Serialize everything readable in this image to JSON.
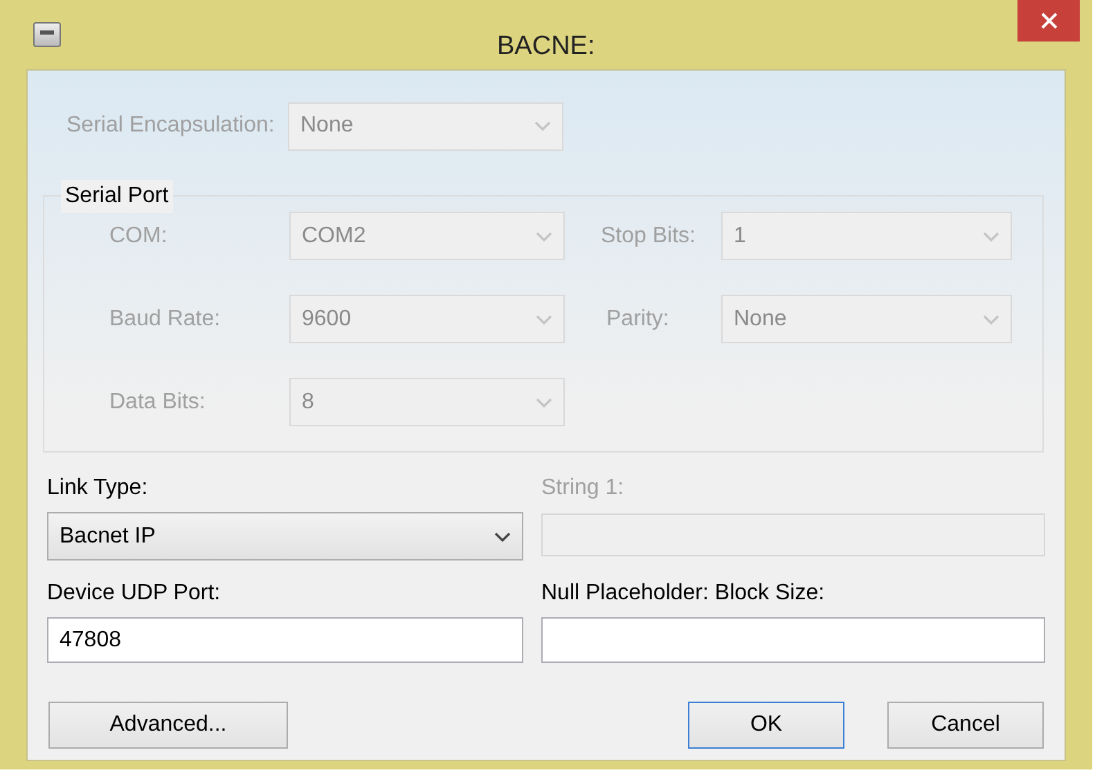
{
  "window": {
    "title": "BACNE:"
  },
  "serial_encapsulation": {
    "label": "Serial Encapsulation:",
    "value": "None",
    "disabled": true
  },
  "serial_port": {
    "title": "Serial Port",
    "fields": [
      {
        "label": "COM:",
        "value": "COM2",
        "disabled": true
      },
      {
        "label": "Stop Bits:",
        "value": "1",
        "disabled": true
      },
      {
        "label": "Baud Rate:",
        "value": "9600",
        "disabled": true
      },
      {
        "label": "Parity:",
        "value": "None",
        "disabled": true
      },
      {
        "label": "Data Bits:",
        "value": "8",
        "disabled": true
      }
    ]
  },
  "link_type": {
    "label": "Link Type:",
    "value": "Bacnet IP",
    "disabled": false
  },
  "string_1": {
    "label": "String 1:",
    "disabled": true
  },
  "device_udp_port": {
    "label": "Device UDP Port:",
    "value": "47808"
  },
  "null_placeholder": {
    "label": "Null Placeholder: Block Size:"
  },
  "buttons": [
    {
      "label": "Advanced...",
      "default": false
    },
    {
      "label": "OK",
      "default": true
    },
    {
      "label": "Cancel",
      "default": false
    }
  ]
}
